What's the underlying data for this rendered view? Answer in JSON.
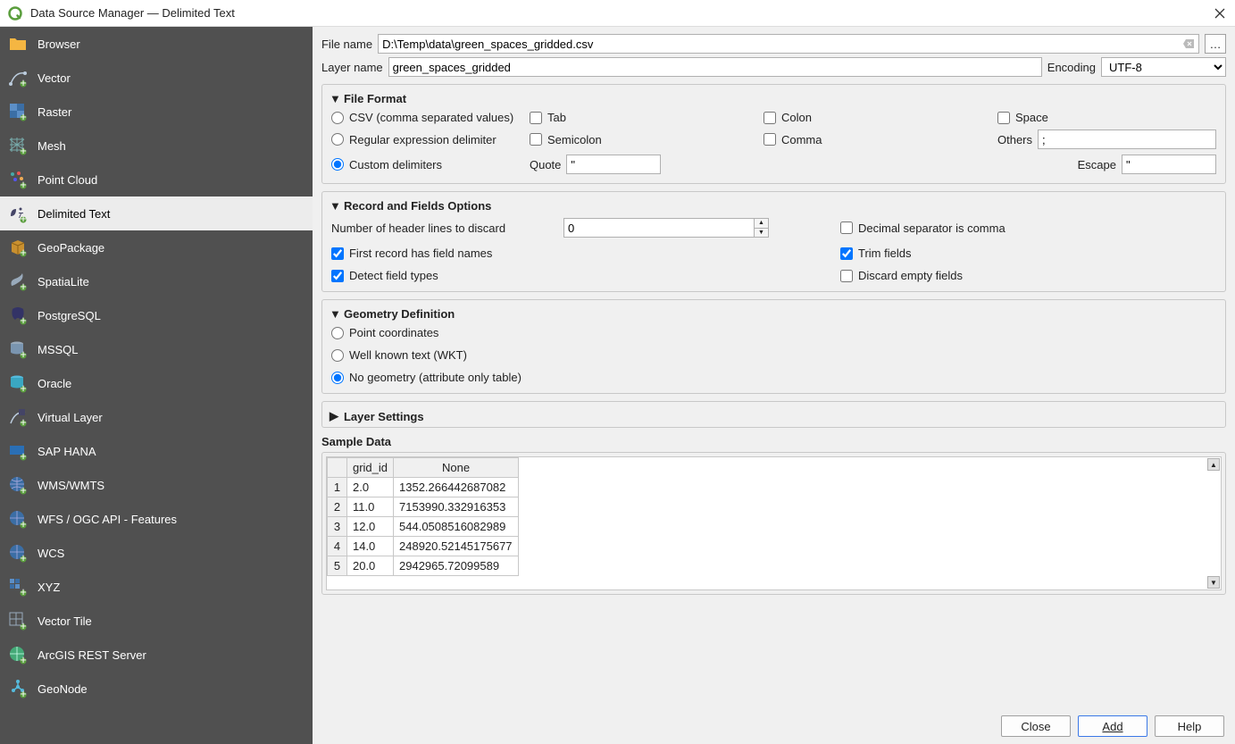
{
  "window": {
    "title": "Data Source Manager — Delimited Text"
  },
  "sidebar": {
    "items": [
      {
        "label": "Browser"
      },
      {
        "label": "Vector"
      },
      {
        "label": "Raster"
      },
      {
        "label": "Mesh"
      },
      {
        "label": "Point Cloud"
      },
      {
        "label": "Delimited Text"
      },
      {
        "label": "GeoPackage"
      },
      {
        "label": "SpatiaLite"
      },
      {
        "label": "PostgreSQL"
      },
      {
        "label": "MSSQL"
      },
      {
        "label": "Oracle"
      },
      {
        "label": "Virtual Layer"
      },
      {
        "label": "SAP HANA"
      },
      {
        "label": "WMS/WMTS"
      },
      {
        "label": "WFS / OGC API - Features"
      },
      {
        "label": "WCS"
      },
      {
        "label": "XYZ"
      },
      {
        "label": "Vector Tile"
      },
      {
        "label": "ArcGIS REST Server"
      },
      {
        "label": "GeoNode"
      }
    ],
    "selected_index": 5
  },
  "form": {
    "file_name_label": "File name",
    "file_name_value": "D:\\Temp\\data\\green_spaces_gridded.csv",
    "layer_name_label": "Layer name",
    "layer_name_value": "green_spaces_gridded",
    "encoding_label": "Encoding",
    "encoding_value": "UTF-8"
  },
  "file_format": {
    "title": "File Format",
    "csv_label": "CSV (comma separated values)",
    "regex_label": "Regular expression delimiter",
    "custom_label": "Custom delimiters",
    "tab_label": "Tab",
    "semicolon_label": "Semicolon",
    "colon_label": "Colon",
    "comma_label": "Comma",
    "space_label": "Space",
    "others_label": "Others",
    "others_value": ";",
    "quote_label": "Quote",
    "quote_value": "\"",
    "escape_label": "Escape",
    "escape_value": "\""
  },
  "record_fields": {
    "title": "Record and Fields Options",
    "header_discard_label": "Number of header lines to discard",
    "header_discard_value": "0",
    "first_record_label": "First record has field names",
    "detect_types_label": "Detect field types",
    "decimal_comma_label": "Decimal separator is comma",
    "trim_fields_label": "Trim fields",
    "discard_empty_label": "Discard empty fields"
  },
  "geometry": {
    "title": "Geometry Definition",
    "point_label": "Point coordinates",
    "wkt_label": "Well known text (WKT)",
    "none_label": "No geometry (attribute only table)"
  },
  "layer_settings": {
    "title": "Layer Settings"
  },
  "sample": {
    "title": "Sample Data",
    "columns": [
      "grid_id",
      "None"
    ],
    "rows": [
      [
        "2.0",
        "1352.266442687082"
      ],
      [
        "11.0",
        "7153990.332916353"
      ],
      [
        "12.0",
        "544.0508516082989"
      ],
      [
        "14.0",
        "248920.52145175677"
      ],
      [
        "20.0",
        "2942965.72099589"
      ]
    ]
  },
  "buttons": {
    "close": "Close",
    "add": "Add",
    "help": "Help"
  }
}
